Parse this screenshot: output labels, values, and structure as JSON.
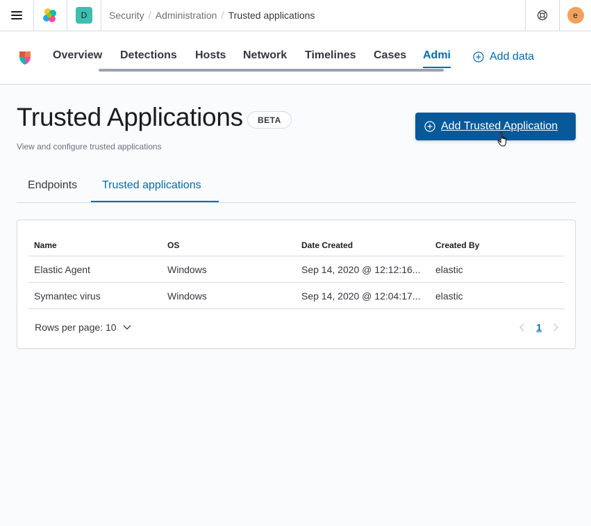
{
  "header": {
    "space_initial": "D",
    "user_initial": "e",
    "breadcrumbs": [
      "Security",
      "Administration",
      "Trusted applications"
    ]
  },
  "nav": {
    "tabs": [
      "Overview",
      "Detections",
      "Hosts",
      "Network",
      "Timelines",
      "Cases",
      "Admi"
    ],
    "active_tab": "Admi",
    "add_data": "Add data"
  },
  "page": {
    "title": "Trusted Applications",
    "badge": "BETA",
    "description": "View and configure trusted applications",
    "add_button": "Add Trusted Application"
  },
  "subtabs": [
    "Endpoints",
    "Trusted applications"
  ],
  "table": {
    "columns": [
      "Name",
      "OS",
      "Date Created",
      "Created By"
    ],
    "rows": [
      [
        "Elastic Agent",
        "Windows",
        "Sep 14, 2020 @ 12:12:16...",
        "elastic"
      ],
      [
        "Symantec virus",
        "Windows",
        "Sep 14, 2020 @ 12:04:17...",
        "elastic"
      ]
    ],
    "rows_per_page": "Rows per page: 10",
    "current_page": "1"
  },
  "colors": {
    "accent": "#006bb4",
    "primary_button": "#07599a",
    "space_avatar": "#3ebeb0",
    "user_avatar": "#f1a15e"
  },
  "icons": [
    "menu-icon",
    "elastic-logo-icon",
    "help-icon",
    "security-app-icon",
    "plus-circle-icon",
    "chevron-down-icon",
    "arrow-left-icon",
    "arrow-right-icon",
    "pointer-cursor-icon"
  ]
}
